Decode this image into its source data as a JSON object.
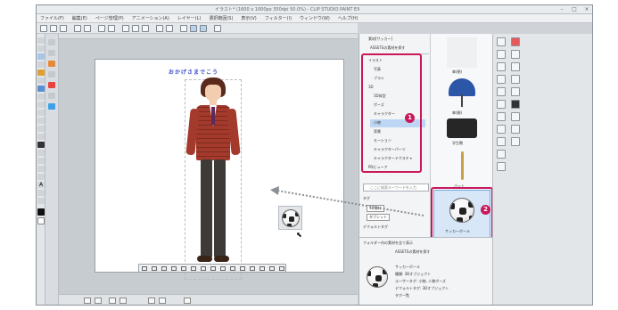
{
  "window": {
    "title": "イラスト* (1600 x 1000px 350dpi 50.0%) - CLIP STUDIO PAINT EX"
  },
  "menu": [
    "ファイル(F)",
    "編集(E)",
    "ページ管理(P)",
    "アニメーション(A)",
    "レイヤー(L)",
    "選択範囲(S)",
    "表示(V)",
    "フィルター(I)",
    "ウィンドウ(W)",
    "ヘルプ(H)"
  ],
  "canvas": {
    "speech_text": "おかげさまでこう"
  },
  "material_panel": {
    "header": "素材[サッカー]",
    "top_item": "ASSETSの素材を探す",
    "tree": [
      "イラスト",
      "写真",
      "ブラシ",
      "3D",
      "3D体型",
      "ポーズ",
      "キャラクター",
      "小物",
      "背景",
      "モーション",
      "キャラクターパーツ",
      "キャラクターテクスチャ",
      "PDビューア"
    ],
    "search_placeholder": "ここに検索キーワードを入力"
  },
  "material_grid": {
    "items": [
      {
        "label": "傘(閉)"
      },
      {
        "label": "傘(開)"
      },
      {
        "label": "学生鞄"
      },
      {
        "label": "バット"
      }
    ],
    "selected": {
      "label": "サッカーボール"
    }
  },
  "detail": {
    "lines": [
      "タグ",
      "3D素材",
      "タブレット",
      "デフォルトタグ",
      "ユーザータグ"
    ],
    "find_more": "フォルダー内の素材を全て表示",
    "assets_link": "ASSETSの素材を探す",
    "item_lines": [
      "サッカーボール",
      "種類: 3Dオブジェクト",
      "ユーザータグ: 小物, 人物ポーズ",
      "デフォルトタグ: 3Dオブジェクト",
      "タグ一覧"
    ]
  },
  "badges": {
    "first": "1",
    "second": "2"
  },
  "colors": {
    "accent": "#c8185a",
    "jacket": "#a43a2c",
    "hair": "#5a2a1c"
  }
}
